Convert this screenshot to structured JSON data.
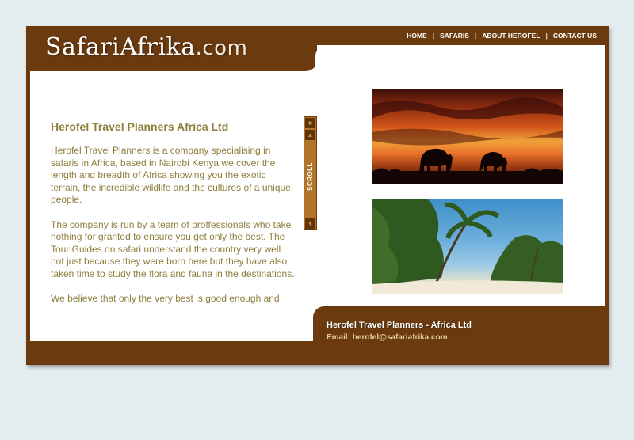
{
  "logo": {
    "main": "SafariAfrika",
    "ext": ".com"
  },
  "nav": {
    "items": [
      "HOME",
      "SAFARIS",
      "ABOUT HEROFEL",
      "CONTACT US"
    ],
    "separator": "|"
  },
  "content": {
    "title": "Herofel Travel Planners Africa Ltd",
    "paragraphs": [
      "Herofel Travel Planners is a company specialising in safaris in Africa, based in Nairobi Kenya we cover the length and breadth of Africa showing you the exotic terrain, the incredible wildlife and the cultures of a unique people.",
      "The company is run by a team of proffessionals who take nothing for granted to ensure you get only the best. The Tour Guides on safari understand the country very well not just because they were born here but they have also taken time to study the flora and fauna in the destinations.",
      "We believe that only the very best is good enough and"
    ]
  },
  "scroll": {
    "label": "SCROLL",
    "up_icon": "arrow-up-icon",
    "down_icon": "arrow-down-icon",
    "top_icon": "scroll-top-icon"
  },
  "images": {
    "sunset": "elephants-sunset-image",
    "beach": "palm-beach-image"
  },
  "footer": {
    "title": "Herofel Travel Planners - Africa Ltd",
    "email": "Email: herofel@safariafrika.com"
  },
  "colors": {
    "brand_brown": "#6b3a0e",
    "text_olive": "#8e7f3d",
    "scroll_tan": "#b0752a",
    "background": "#e3ecef"
  }
}
